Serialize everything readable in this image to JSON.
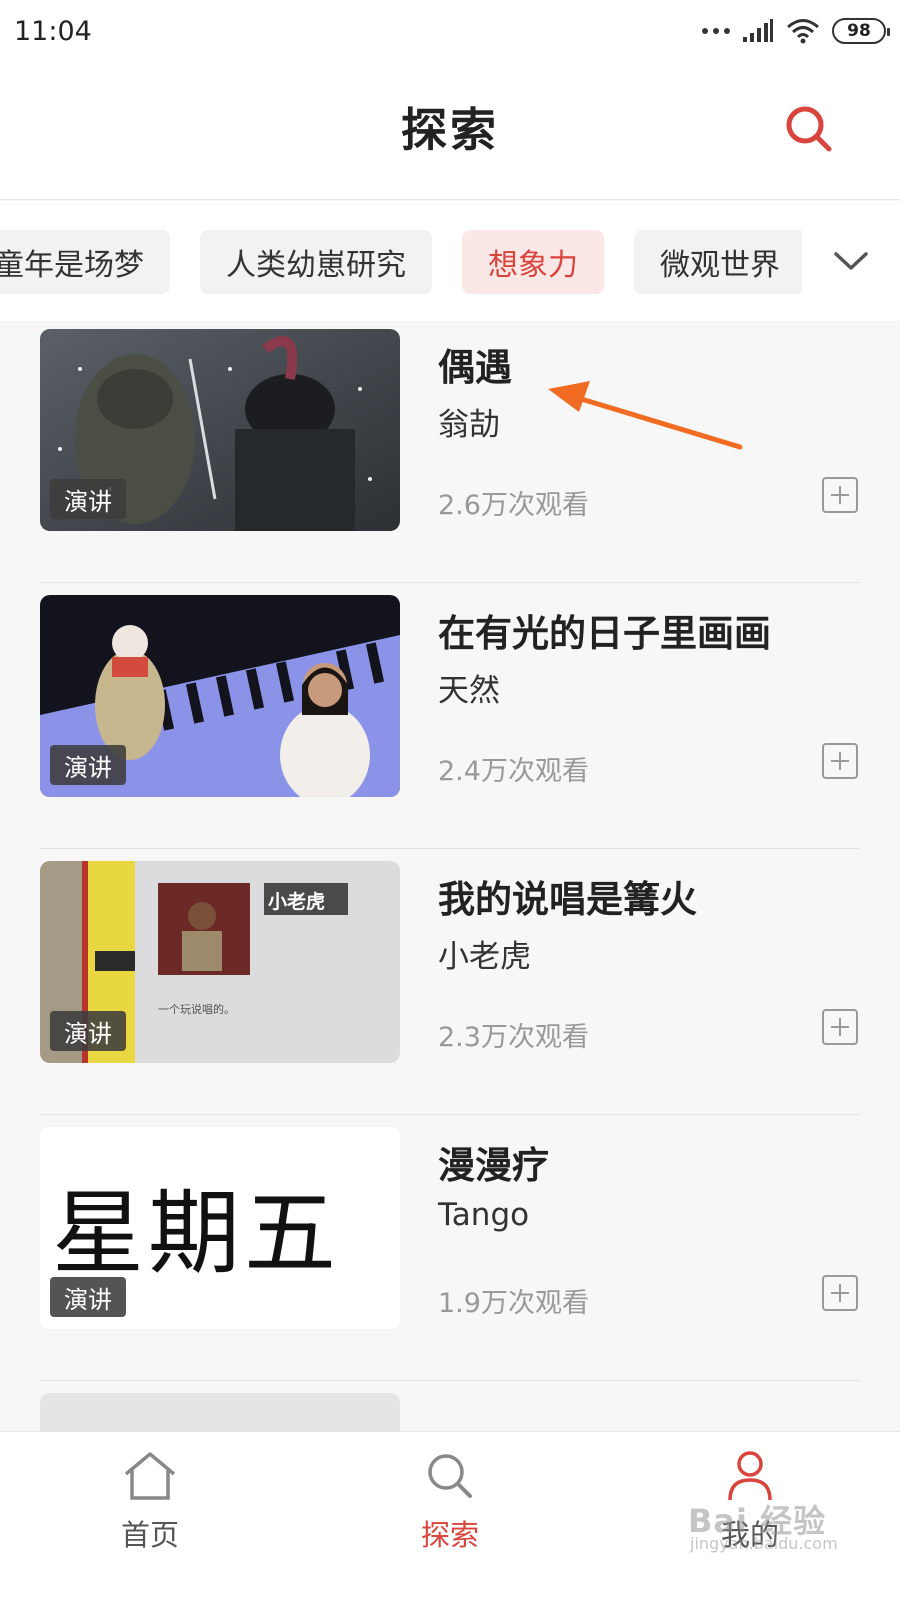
{
  "status_bar": {
    "time": "11:04",
    "battery": "98"
  },
  "header": {
    "title": "探索",
    "search_icon": "search-icon"
  },
  "categories": {
    "items": [
      "童年是场梦",
      "人类幼崽研究",
      "想象力",
      "微观世界"
    ],
    "active_index": 2,
    "expand_icon": "chevron-down-icon"
  },
  "list": {
    "items": [
      {
        "title": "偶遇",
        "speaker": "翁劼",
        "views": "2.6万次观看",
        "tag": "演讲"
      },
      {
        "title": "在有光的日子里画画",
        "speaker": "天然",
        "views": "2.4万次观看",
        "tag": "演讲"
      },
      {
        "title": "我的说唱是篝火",
        "speaker": "小老虎",
        "views": "2.3万次观看",
        "tag": "演讲",
        "thumb_caption": "小老虎",
        "thumb_subcaption": "一个玩说唱的。"
      },
      {
        "title": "漫漫疗",
        "speaker": "Tango",
        "views": "1.9万次观看",
        "tag": "演讲",
        "thumb_text": "星期五"
      }
    ]
  },
  "bottom_nav": {
    "items": [
      {
        "label": "首页",
        "icon": "home-icon"
      },
      {
        "label": "探索",
        "icon": "search-icon",
        "active": true
      },
      {
        "label": "我的",
        "icon": "user-icon"
      }
    ]
  },
  "watermark": {
    "text": "Bai 经验",
    "sub": "jingyan.baidu.com"
  },
  "colors": {
    "accent": "#d9443c",
    "arrow": "#f26b22"
  }
}
